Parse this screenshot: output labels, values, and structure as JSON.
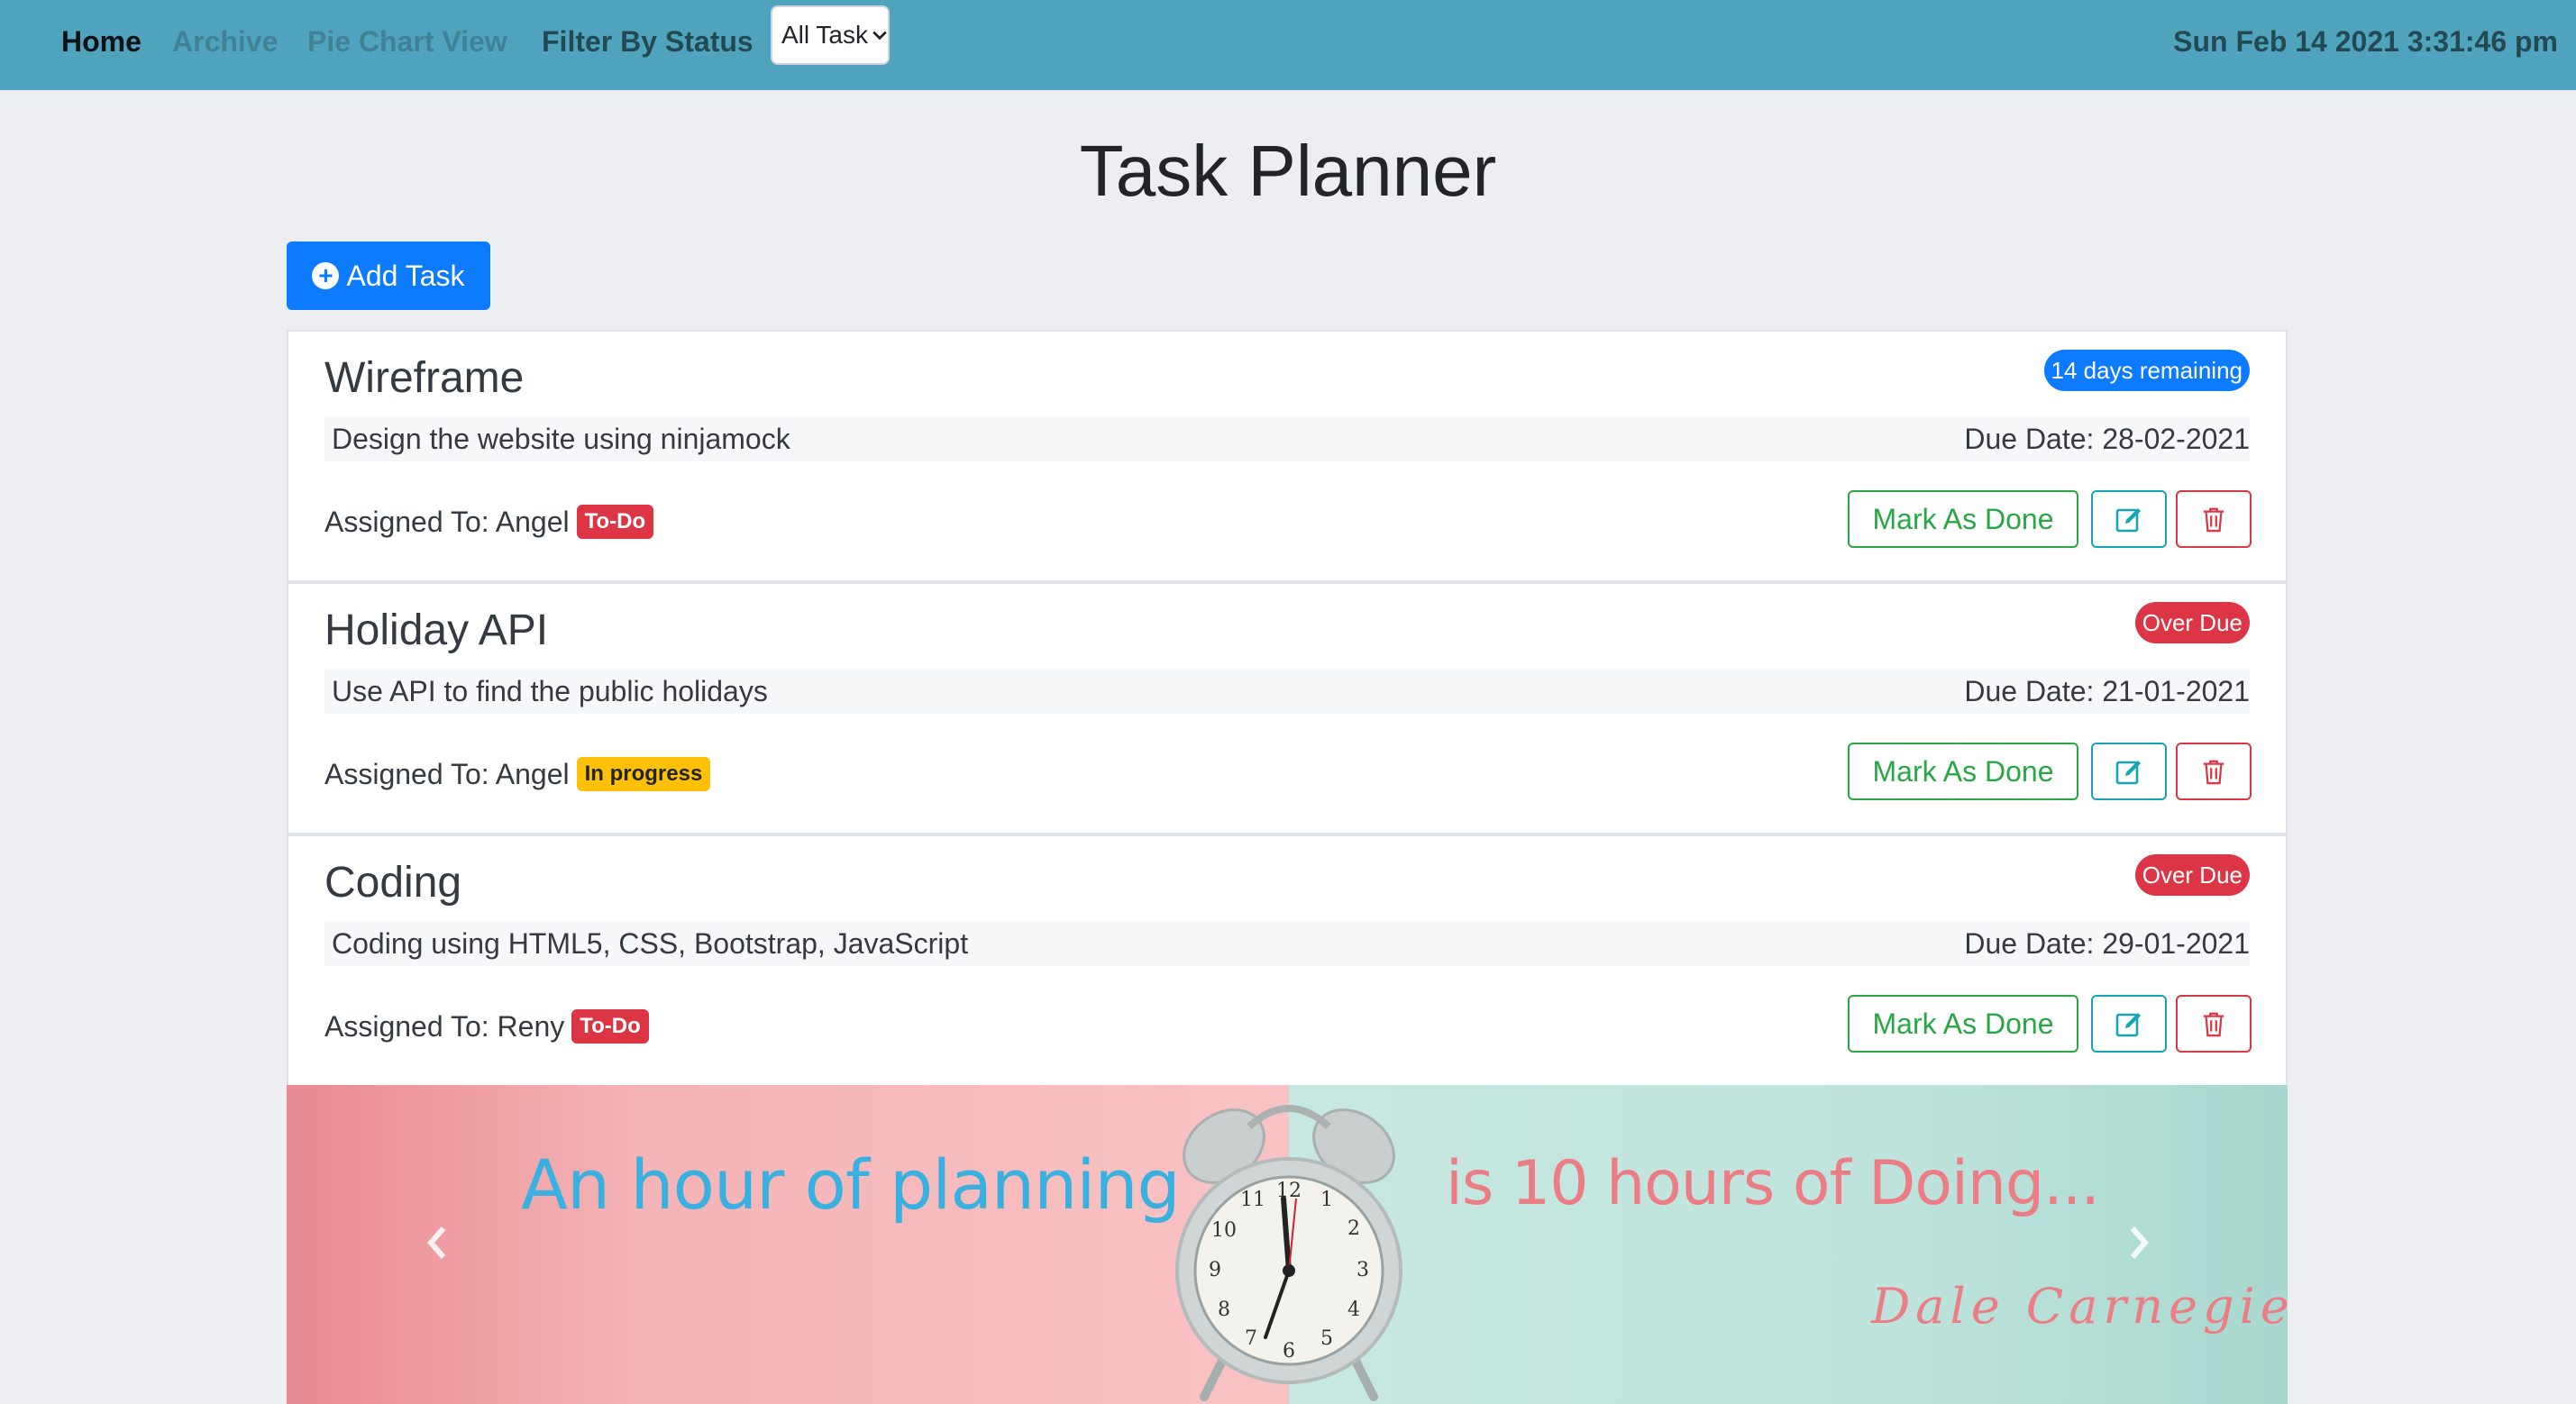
{
  "nav": {
    "home": "Home",
    "archive": "Archive",
    "pie_chart": "Pie Chart View",
    "filter_label": "Filter By Status",
    "filter_value": "All Task",
    "datetime": "Sun Feb 14 2021 3:31:46 pm"
  },
  "page_title": "Task Planner",
  "add_task_label": "Add Task",
  "tasks": [
    {
      "title": "Wireframe",
      "remaining": "14 days remaining",
      "remaining_color": "#0d7bff",
      "description": "Design the website using ninjamock",
      "due": "Due Date: 28-02-2021",
      "assigned": "Assigned To: Angel",
      "status": "To-Do",
      "status_bg": "#dc3545",
      "status_fg": "#ffffff",
      "done_label": "Mark As Done"
    },
    {
      "title": "Holiday API",
      "remaining": "Over Due",
      "remaining_color": "#dc3545",
      "description": "Use API to find the public holidays",
      "due": "Due Date: 21-01-2021",
      "assigned": "Assigned To: Angel",
      "status": "In progress",
      "status_bg": "#ffc107",
      "status_fg": "#212529",
      "done_label": "Mark As Done"
    },
    {
      "title": "Coding",
      "remaining": "Over Due",
      "remaining_color": "#dc3545",
      "description": "Coding using HTML5, CSS, Bootstrap, JavaScript",
      "due": "Due Date: 29-01-2021",
      "assigned": "Assigned To: Reny",
      "status": "To-Do",
      "status_bg": "#dc3545",
      "status_fg": "#ffffff",
      "done_label": "Mark As Done"
    }
  ],
  "banner": {
    "quote_part1": "An hour of planning",
    "quote_part2": "is 10 hours of Doing...",
    "author": "Dale Carnegie"
  },
  "icons": {
    "add": "plus-circle-icon",
    "edit": "pencil-square-icon",
    "delete": "trash-icon",
    "prev": "chevron-left-icon",
    "next": "chevron-right-icon",
    "clock": "alarm-clock-icon"
  }
}
